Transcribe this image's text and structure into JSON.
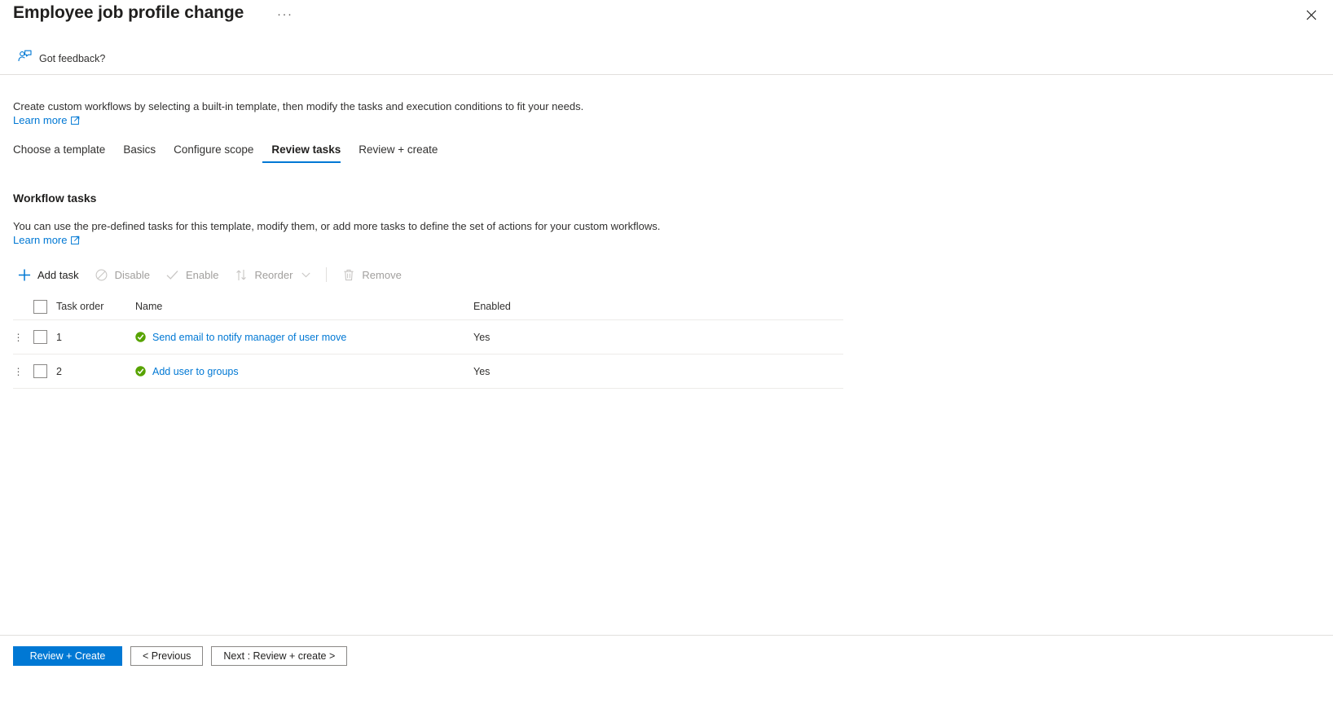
{
  "header": {
    "title": "Employee job profile change",
    "more_label": "···",
    "close_icon": "close-icon"
  },
  "feedback": {
    "label": "Got feedback?",
    "icon": "feedback-person-icon"
  },
  "intro": {
    "text": "Create custom workflows by selecting a built-in template, then modify the tasks and execution conditions to fit your needs.",
    "learn_more": "Learn more"
  },
  "tabs": [
    {
      "label": "Choose a template",
      "active": false
    },
    {
      "label": "Basics",
      "active": false
    },
    {
      "label": "Configure scope",
      "active": false
    },
    {
      "label": "Review tasks",
      "active": true
    },
    {
      "label": "Review + create",
      "active": false
    }
  ],
  "section": {
    "title": "Workflow tasks",
    "description": "You can use the pre-defined tasks for this template, modify them, or add more tasks to define the set of actions for your custom workflows.",
    "learn_more": "Learn more"
  },
  "commandbar": [
    {
      "label": "Add task",
      "icon": "plus-icon",
      "disabled": false
    },
    {
      "label": "Disable",
      "icon": "block-circle-icon",
      "disabled": true
    },
    {
      "label": "Enable",
      "icon": "checkmark-icon",
      "disabled": true
    },
    {
      "label": "Reorder",
      "icon": "sort-arrows-icon",
      "disabled": true,
      "has_chevron": true
    },
    {
      "label": "Remove",
      "icon": "trash-icon",
      "disabled": true
    }
  ],
  "table": {
    "columns": {
      "task_order": "Task order",
      "name": "Name",
      "enabled": "Enabled"
    },
    "rows": [
      {
        "order": "1",
        "name": "Send email to notify manager of user move",
        "enabled": "Yes",
        "status_icon": "green-check-circle-icon"
      },
      {
        "order": "2",
        "name": "Add user to groups",
        "enabled": "Yes",
        "status_icon": "green-check-circle-icon"
      }
    ]
  },
  "footer": {
    "primary": "Review + Create",
    "previous": "< Previous",
    "next": "Next : Review + create >"
  },
  "colors": {
    "accent": "#0078d4",
    "link": "#0078d4",
    "success": "#57a300",
    "disabled_text": "#a19f9d",
    "border": "#e1dfdd"
  }
}
